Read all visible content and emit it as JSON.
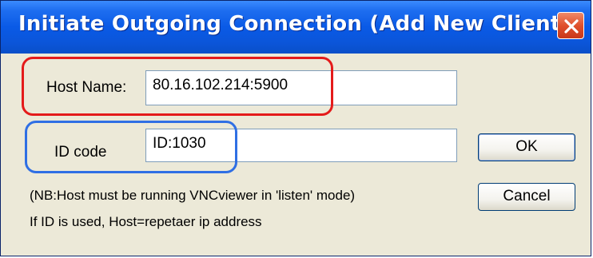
{
  "window": {
    "title": "Initiate Outgoing Connection (Add New Client)",
    "close_icon": "close-icon"
  },
  "form": {
    "host_label": "Host Name:",
    "host_value": "80.16.102.214:5900",
    "id_label": "ID code",
    "id_value": "ID:1030"
  },
  "buttons": {
    "ok_label": "OK",
    "cancel_label": "Cancel"
  },
  "notes": {
    "line1": "(NB:Host must be running VNCviewer in 'listen' mode)",
    "line2": "If ID is used, Host=repetaer ip address"
  },
  "colors": {
    "titlebar": "#0a5ae6",
    "dialog_background": "#ece9d8",
    "highlight_host": "#e41b1b",
    "highlight_id": "#2f6fe4",
    "close_button": "#e0502c"
  }
}
